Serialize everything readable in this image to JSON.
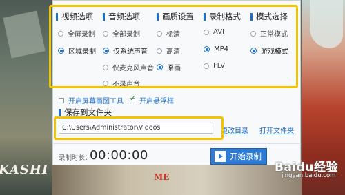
{
  "columns": [
    {
      "id": "video",
      "title": "视频选项",
      "options": [
        {
          "label": "全屏录制",
          "selected": false
        },
        {
          "label": "区域录制",
          "selected": true
        }
      ]
    },
    {
      "id": "audio",
      "title": "音频选项",
      "options": [
        {
          "label": "全部录制",
          "selected": false
        },
        {
          "label": "仅系统声音",
          "selected": true
        },
        {
          "label": "仅麦克风声音",
          "selected": false
        },
        {
          "label": "不录声音",
          "selected": false
        }
      ]
    },
    {
      "id": "quality",
      "title": "画质设置",
      "options": [
        {
          "label": "标清",
          "selected": false
        },
        {
          "label": "高清",
          "selected": false
        },
        {
          "label": "原画",
          "selected": true
        }
      ]
    },
    {
      "id": "format",
      "title": "录制格式",
      "options": [
        {
          "label": "AVI",
          "selected": false
        },
        {
          "label": "MP4",
          "selected": true
        },
        {
          "label": "FLV",
          "selected": false
        }
      ]
    },
    {
      "id": "mode",
      "title": "模式选择",
      "options": [
        {
          "label": "正常模式",
          "selected": false
        },
        {
          "label": "游戏模式",
          "selected": true
        }
      ]
    }
  ],
  "checkboxes": [
    {
      "label": "开启屏幕画图工具",
      "checked": false
    },
    {
      "label": "开启悬浮框",
      "checked": true
    }
  ],
  "save": {
    "title": "保存到文件夹",
    "path": "C:\\Users\\Administrator\\Videos",
    "change_dir": "更改目录",
    "open_folder": "打开文件夹"
  },
  "footer": {
    "duration_label": "录制时长：",
    "duration_value": "00:00:00",
    "start_label": "开始录制"
  },
  "background": {
    "left_text": "KASHI",
    "bottom_text": "ME"
  },
  "watermark": {
    "logo": "Baidu经验",
    "url": "jingyan.baidu.com"
  },
  "colors": {
    "accent": "#1f6fc5",
    "highlight": "#f5c400",
    "button": "#2f7bd3"
  }
}
